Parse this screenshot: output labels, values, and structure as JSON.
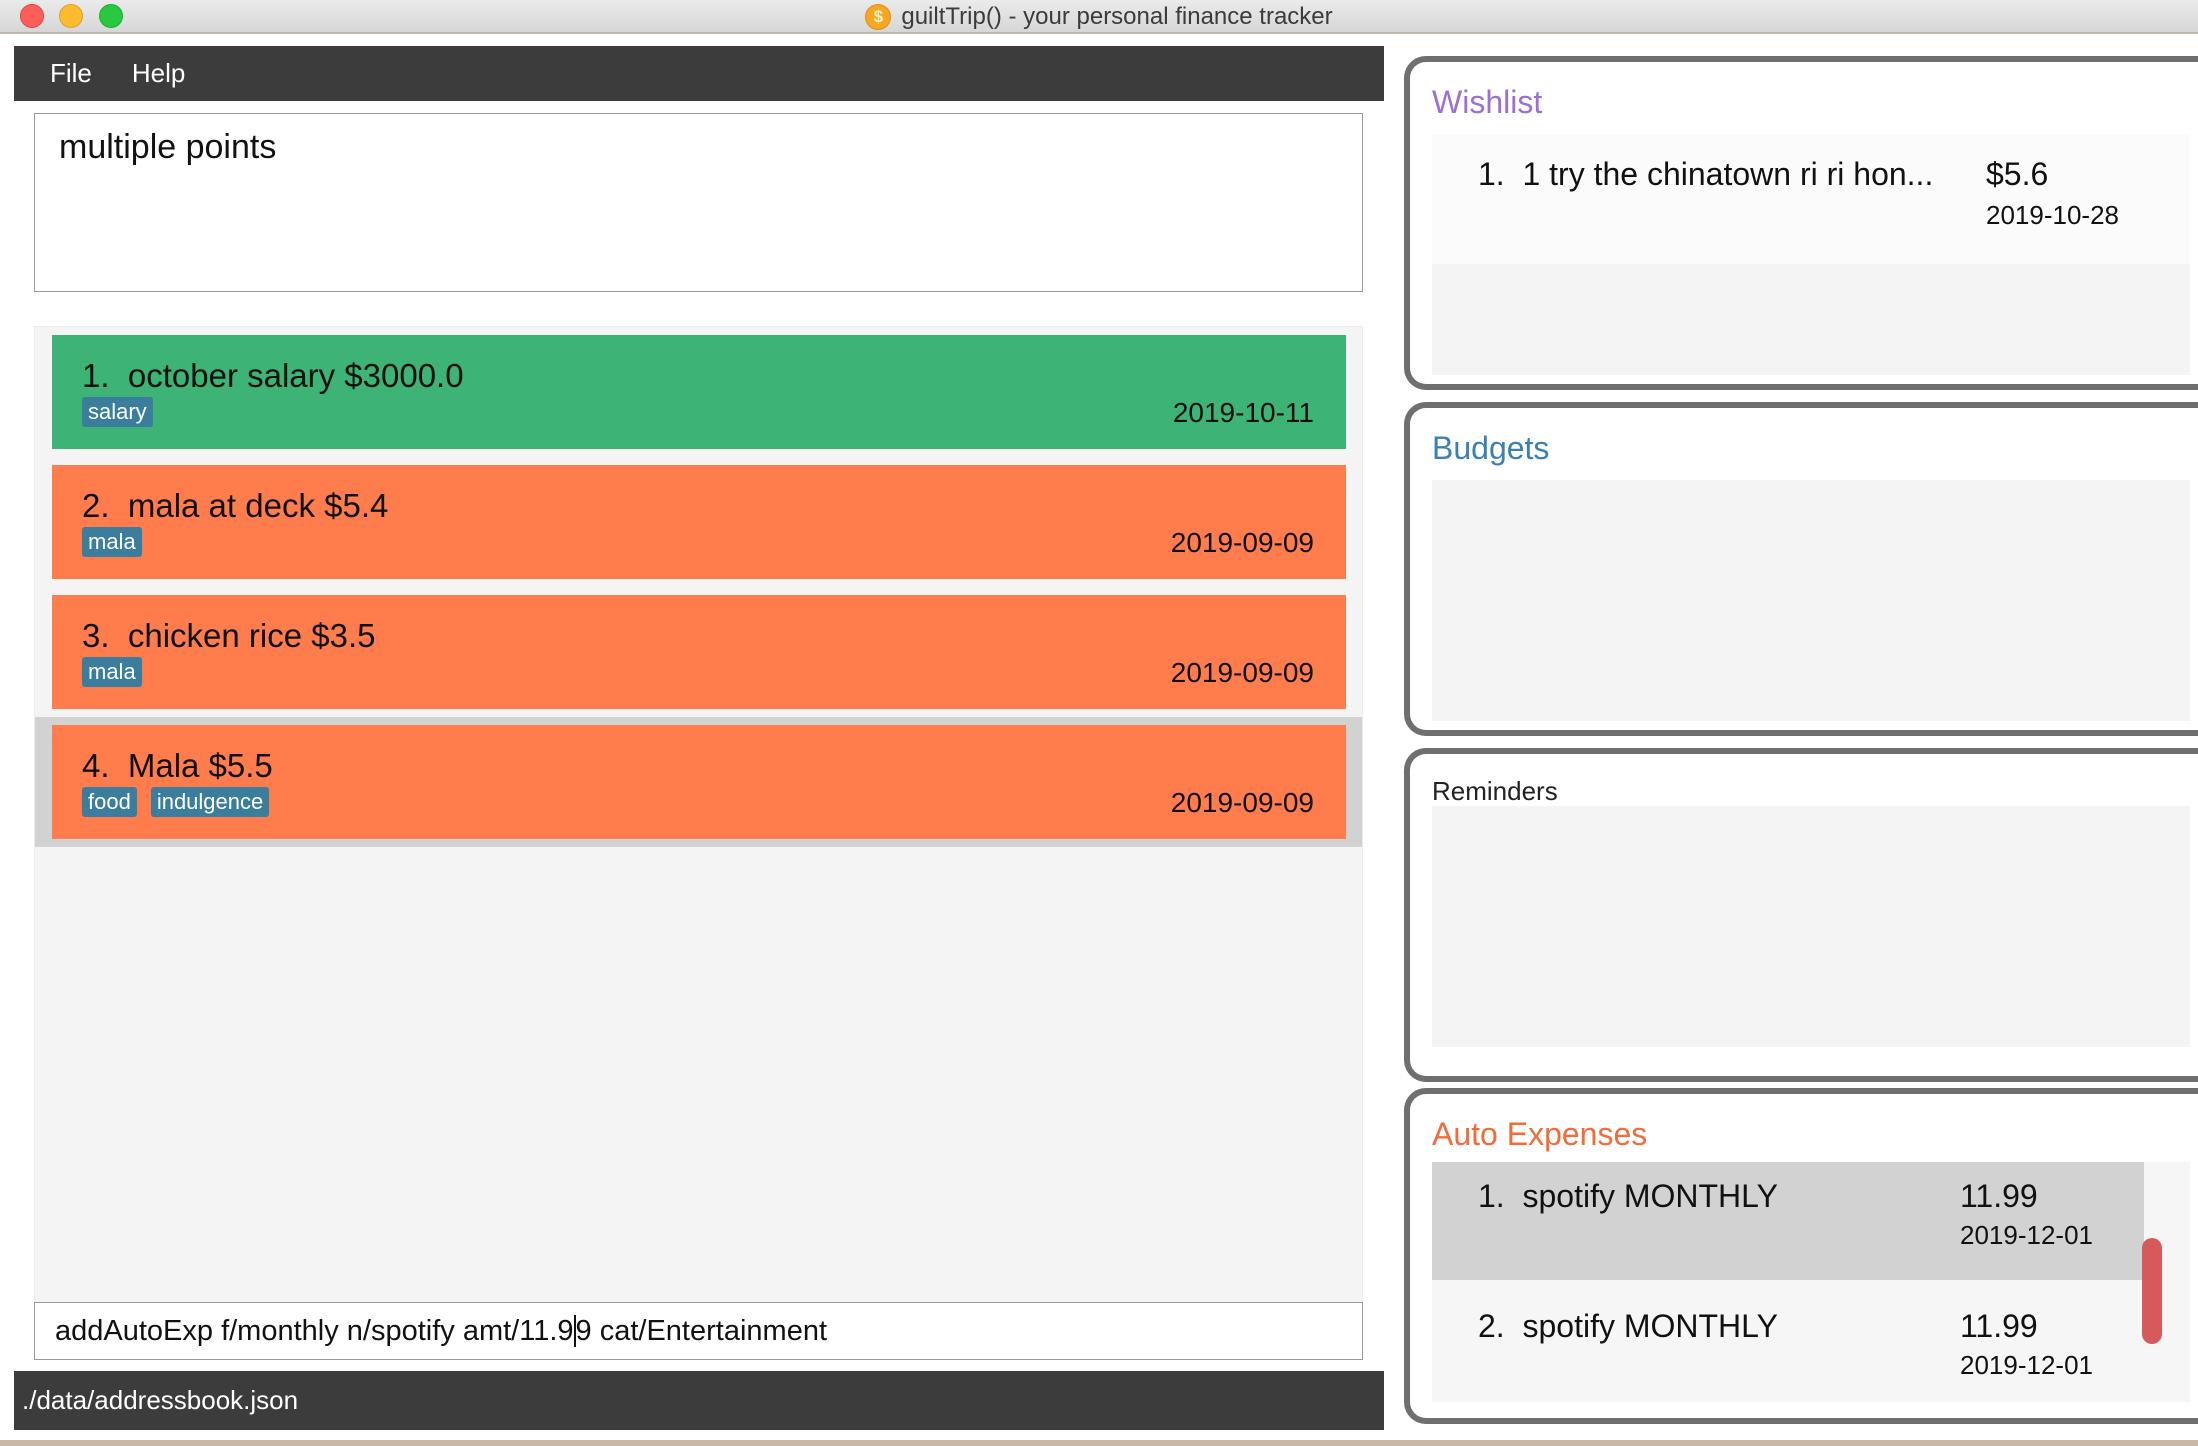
{
  "window": {
    "title": "guiltTrip() - your personal finance tracker",
    "app_icon_glyph": "$"
  },
  "menu": {
    "items": [
      "File",
      "Help"
    ]
  },
  "result_display": {
    "text": "multiple points"
  },
  "entries": [
    {
      "title": "1.  october salary $3000.0",
      "tags": [
        "salary"
      ],
      "date": "2019-10-11",
      "kind": "income"
    },
    {
      "title": "2.  mala at deck $5.4",
      "tags": [
        "mala"
      ],
      "date": "2019-09-09",
      "kind": "expense"
    },
    {
      "title": "3.  chicken rice $3.5",
      "tags": [
        "mala"
      ],
      "date": "2019-09-09",
      "kind": "expense"
    },
    {
      "title": "4.  Mala $5.5",
      "tags": [
        "food",
        "indulgence"
      ],
      "date": "2019-09-09",
      "kind": "expense",
      "selected": true
    }
  ],
  "command_box": {
    "text_before_caret": "addAutoExp f/monthly n/spotify amt/11.9",
    "text_after_caret": "9 cat/Entertainment"
  },
  "status_bar": {
    "path": "./data/addressbook.json"
  },
  "wishlist": {
    "title": "Wishlist",
    "color": "#9b6fd6",
    "items": [
      {
        "title": "1.  1 try the chinatown ri ri hon...",
        "amount": "$5.6",
        "date": "2019-10-28"
      }
    ]
  },
  "budgets": {
    "title": "Budgets",
    "color": "#3a7fb5"
  },
  "reminders": {
    "title": "Reminders"
  },
  "auto_expenses": {
    "title": "Auto Expenses",
    "color": "#f26b3a",
    "items": [
      {
        "title": "1.  spotify MONTHLY",
        "amount": "11.99",
        "date": "2019-12-01",
        "selected": true
      },
      {
        "title": "2.  spotify MONTHLY",
        "amount": "11.99",
        "date": "2019-12-01"
      }
    ]
  },
  "colors": {
    "income": "#3db375",
    "expense": "#ff7c4d",
    "tag": "#3a7d9c",
    "bar": "#3c3c3c",
    "scroll_thumb": "#d65a5a"
  }
}
